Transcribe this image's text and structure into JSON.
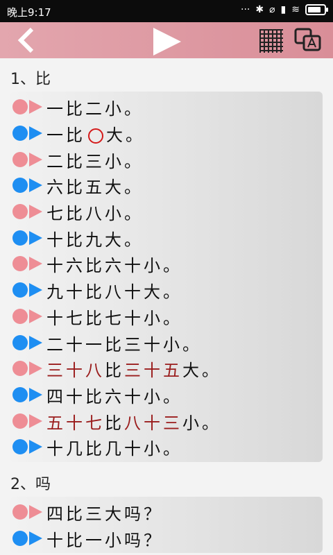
{
  "status_bar": {
    "time": "晚上9:17"
  },
  "sections": [
    {
      "title": "1、比",
      "rows": [
        {
          "style": "pink",
          "parts": [
            {
              "t": "一比二小。",
              "c": ""
            }
          ]
        },
        {
          "style": "blue",
          "parts": [
            {
              "t": "一比",
              "c": ""
            },
            {
              "t": "",
              "c": "circle"
            },
            {
              "t": "大。",
              "c": ""
            }
          ]
        },
        {
          "style": "pink",
          "parts": [
            {
              "t": "二比三小。",
              "c": ""
            }
          ]
        },
        {
          "style": "blue",
          "parts": [
            {
              "t": "六比五大。",
              "c": ""
            }
          ]
        },
        {
          "style": "pink",
          "parts": [
            {
              "t": "七比八小。",
              "c": ""
            }
          ]
        },
        {
          "style": "blue",
          "parts": [
            {
              "t": "十比九大。",
              "c": ""
            }
          ]
        },
        {
          "style": "pink",
          "parts": [
            {
              "t": "十六比六十小。",
              "c": ""
            }
          ]
        },
        {
          "style": "blue",
          "parts": [
            {
              "t": "九十比八十大。",
              "c": ""
            }
          ]
        },
        {
          "style": "pink",
          "parts": [
            {
              "t": "十七比七十小。",
              "c": ""
            }
          ]
        },
        {
          "style": "blue",
          "parts": [
            {
              "t": "二十一比三十小。",
              "c": ""
            }
          ]
        },
        {
          "style": "pink",
          "parts": [
            {
              "t": "三十八",
              "c": "red"
            },
            {
              "t": "比",
              "c": ""
            },
            {
              "t": "三十五",
              "c": "red"
            },
            {
              "t": "大。",
              "c": ""
            }
          ]
        },
        {
          "style": "blue",
          "parts": [
            {
              "t": "四十比六十小。",
              "c": ""
            }
          ]
        },
        {
          "style": "pink",
          "parts": [
            {
              "t": "五十七",
              "c": "red"
            },
            {
              "t": "比",
              "c": ""
            },
            {
              "t": "八十三",
              "c": "red"
            },
            {
              "t": "小。",
              "c": ""
            }
          ]
        },
        {
          "style": "blue",
          "parts": [
            {
              "t": "十几比几十小。",
              "c": ""
            }
          ]
        }
      ]
    },
    {
      "title": "2、吗",
      "rows": [
        {
          "style": "pink",
          "parts": [
            {
              "t": "四比三大吗？",
              "c": ""
            }
          ]
        },
        {
          "style": "blue",
          "parts": [
            {
              "t": "十比一小吗？",
              "c": ""
            }
          ]
        }
      ]
    }
  ],
  "colors": {
    "pink": "#ee8d95",
    "blue": "#1e8ef2",
    "red_text": "#9a1c1c",
    "header": "#d98e98"
  },
  "icons": {
    "back": "chevron-left-icon",
    "play": "play-icon",
    "grid": "grid-icon",
    "translate": "translate-icon"
  }
}
